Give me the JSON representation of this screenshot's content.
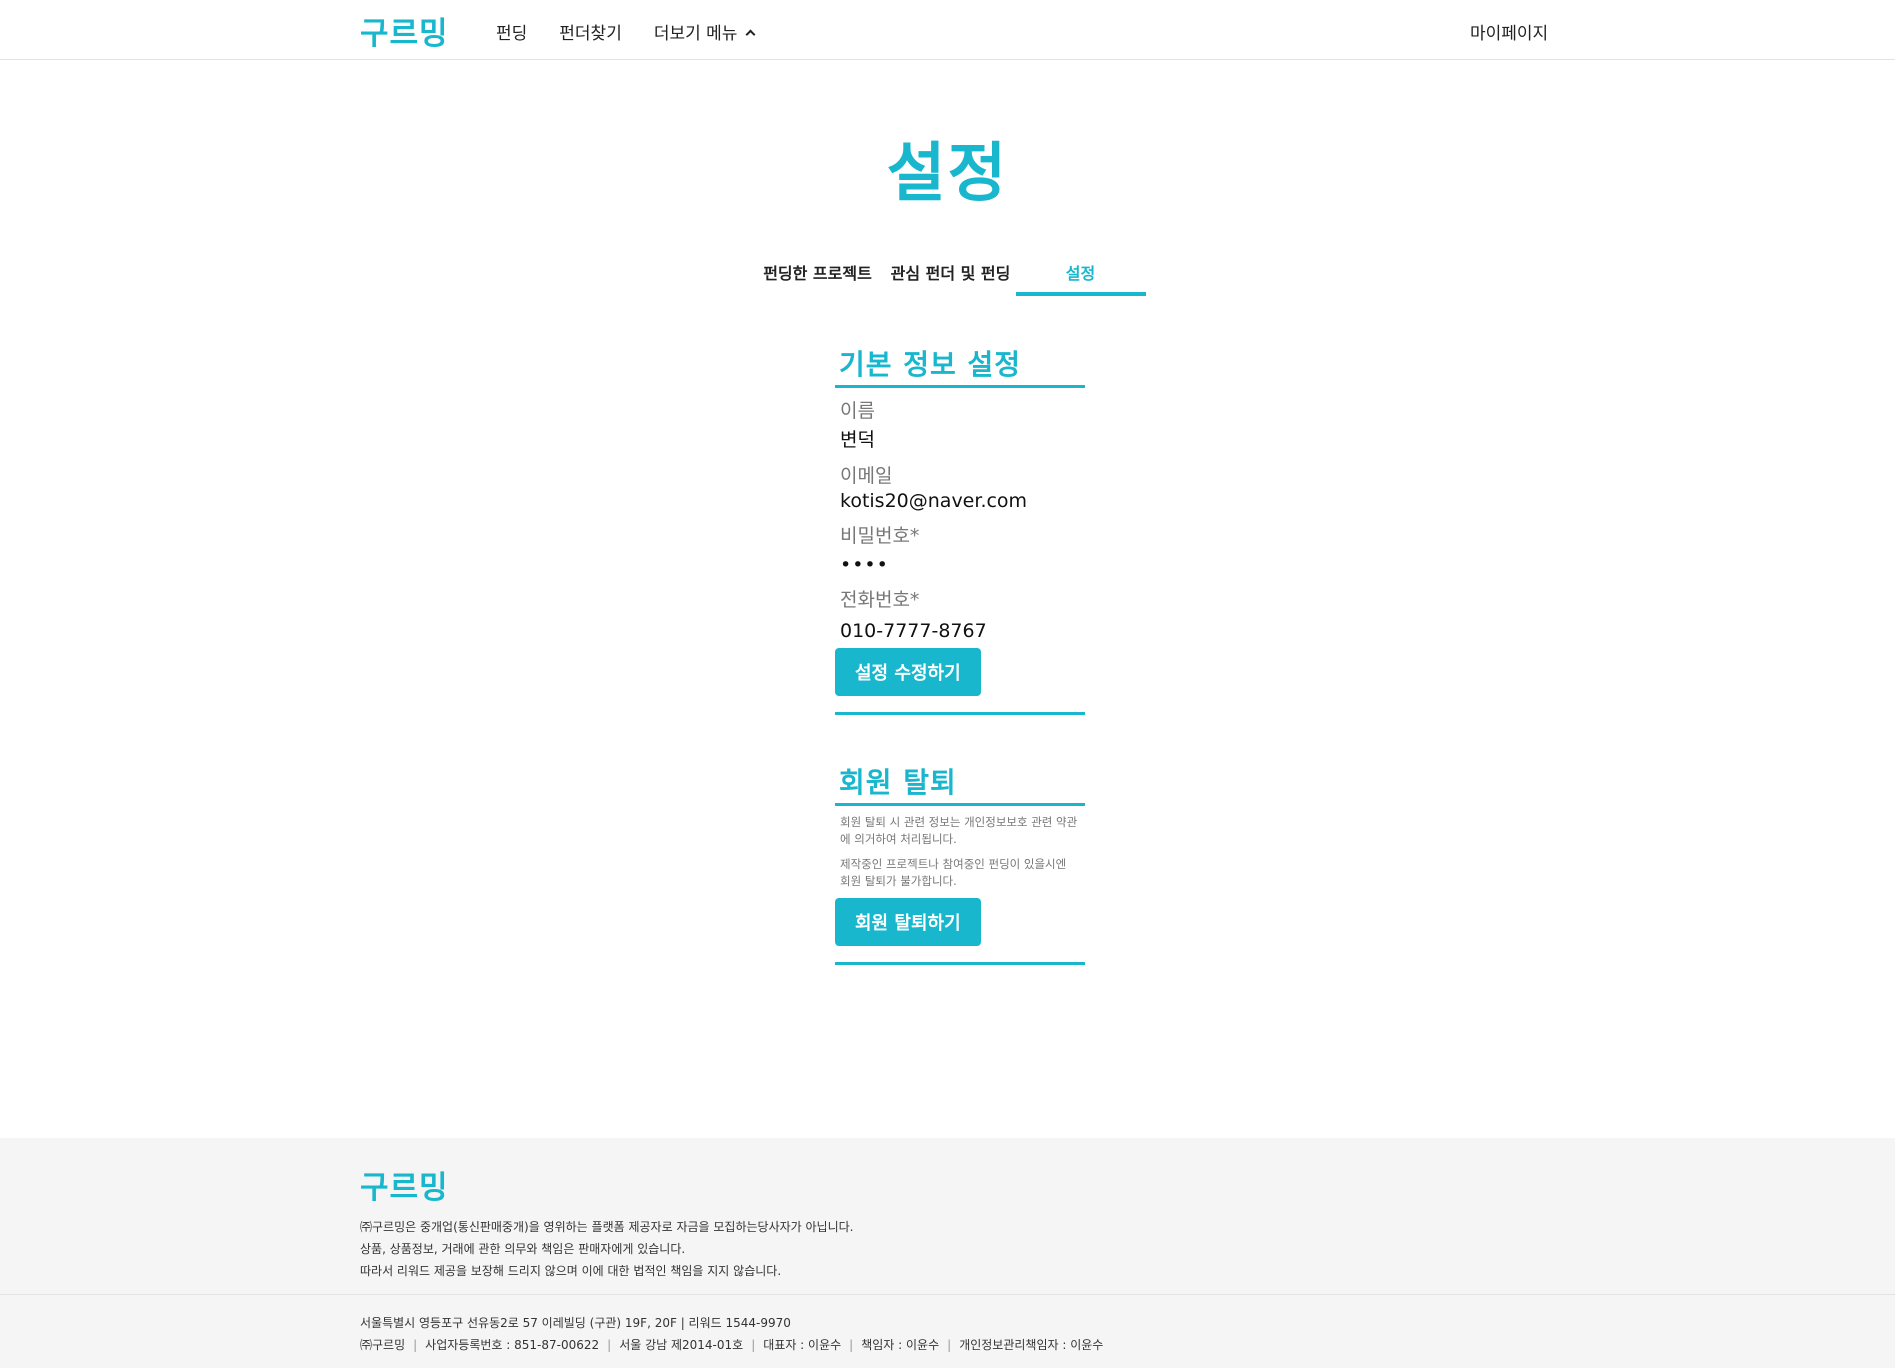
{
  "header": {
    "logo": "구르밍",
    "nav": [
      "펀딩",
      "펀더찾기",
      "더보기 메뉴"
    ],
    "mypage": "마이페이지"
  },
  "page": {
    "title": "설정",
    "tabs": [
      "펀딩한 프로젝트",
      "관심 펀더 및 펀딩",
      "설정"
    ],
    "active_tab": "설정"
  },
  "basic_info": {
    "title": "기본 정보 설정",
    "name_label": "이름",
    "name_value": "변덕",
    "email_label": "이메일",
    "email_value": "kotis20@naver.com",
    "password_label": "비밀번호*",
    "password_value": "••••",
    "phone_label": "전화번호*",
    "phone_value": "010-7777-8767",
    "submit_label": "설정 수정하기"
  },
  "withdraw": {
    "title": "회원 탈퇴",
    "note1_line1": "회원 탈퇴 시 관련 정보는 개인정보보호 관련 약관",
    "note1_line2": "에 의거하여 처리됩니다.",
    "note2_line1": "제작중인 프로젝트나 참여중인 펀딩이 있을시엔",
    "note2_line2": "회원 탈퇴가 불가합니다.",
    "button_label": "회원 탈퇴하기"
  },
  "footer": {
    "logo": "구르밍",
    "lines": [
      "㈜구르밍은 중개업(통신판매중개)을 영위하는 플랫폼 제공자로 자금을 모집하는당사자가 아닙니다.",
      "상품, 상품정보, 거래에 관한 의무와 책임은 판매자에게 있습니다.",
      "따라서 리워드 제공을 보장해 드리지 않으며 이에 대한 법적인 책임을 지지 않습니다."
    ],
    "address": "서울특별시 영등포구 선유동2로 57 이레빌딩 (구관) 19F, 20F | 리워드 1544-9970",
    "company": "㈜구르밍",
    "business_no": "사업자등록번호 : 851-87-00622",
    "registration": "서울 강남 제2014-01호",
    "ceo": "대표자 : 이윤수",
    "manager": "책임자 : 이윤수",
    "privacy_manager": "개인정보관리책임자 : 이윤수"
  }
}
